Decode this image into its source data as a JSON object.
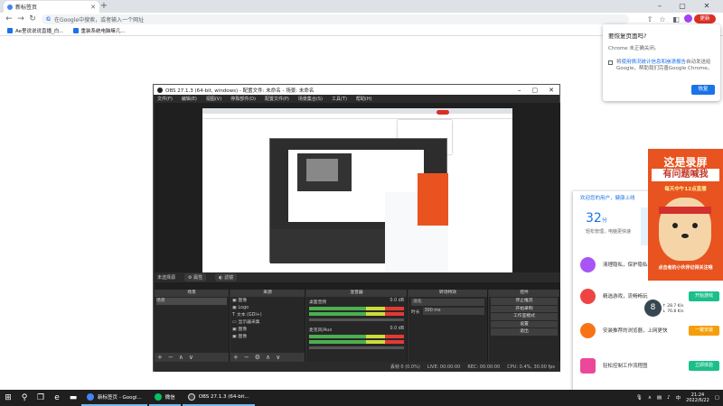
{
  "browser": {
    "tab_title": "新标签页",
    "omnibox_placeholder": "在Google中搜索，或者输入一个网址",
    "update_label": "更新",
    "bookmarks": [
      "Ae里说说说直播_白...",
      "重装系统电脑嘛几..."
    ]
  },
  "restore_popup": {
    "title": "要恢复页面吗?",
    "subtitle": "Chrome 未正确关闭。",
    "checkbox_text_a": "将",
    "checkbox_link": "使用情况统计信息和崩溃报告",
    "checkbox_text_b": "自动发送给Google，帮助我们完善Google Chrome。",
    "button": "恢复"
  },
  "obs": {
    "title": "OBS 27.1.3 (64-bit, windows) - 配置文件: 未命名 - 场景: 未命名",
    "menu": [
      "文件(F)",
      "编辑(E)",
      "视图(V)",
      "停靠部件(D)",
      "配置文件(P)",
      "场景集合(S)",
      "工具(T)",
      "帮助(H)"
    ],
    "source_bar": {
      "label": "未选择源",
      "props": "属性",
      "filters": "滤镜"
    },
    "panels": {
      "scenes": {
        "title": "场景",
        "items": [
          "场景"
        ]
      },
      "sources": {
        "title": "来源",
        "items": [
          "图像",
          "Logo",
          "文本 (GDI+)",
          "显示器采集",
          "图像",
          "图像"
        ]
      },
      "mixer": {
        "title": "混音器",
        "ch1": "桌面音频",
        "ch1_db": "0.0 dB",
        "ch2": "麦克风/Aux",
        "ch2_db": "0.0 dB"
      },
      "transitions": {
        "title": "转场特效",
        "type": "淡化",
        "duration_label": "时长",
        "duration_value": "300 ms"
      },
      "controls": {
        "title": "控件",
        "buttons": [
          "停止推流",
          "开始录制",
          "工作室模式",
          "设置",
          "退出"
        ]
      }
    },
    "status": {
      "dropped": "丢帧 0 (0.0%)",
      "live": "LIVE: 00:00:00",
      "rec": "REC: 00:00:00",
      "cpu": "CPU: 0.4%, 30.00 fps"
    }
  },
  "banner": {
    "line1": "这是录屏",
    "line2": "有问题喊我",
    "line3": "每天中午12点直播",
    "line4": "点击者的小伙伴记得关注哦"
  },
  "side_panel": {
    "header": "欢迎您的用户，健康上线",
    "score": "32",
    "score_unit": "分",
    "score_sub": "轻松管理，电脑更快速",
    "features": [
      {
        "text": "清理隐私，保护隐私安全",
        "button": "",
        "color": "#a855f7"
      },
      {
        "text": "精选游戏，流畅畅玩",
        "button": "开始游戏",
        "btn_color": "#1bbf8a",
        "color": "#ef4444"
      },
      {
        "text": "安装推荐的浏览器，上网更快",
        "button": "一键安装",
        "btn_color": "#f59e0b",
        "color": "#f97316"
      },
      {
        "text": "轻松控制工作流程图",
        "button": "立即体验",
        "btn_color": "#1bbf8a",
        "color": "#ec4899"
      }
    ]
  },
  "speed": {
    "ball": "8",
    "up": "↑ 28.7 K/s",
    "down": "↓ 76.8 K/s"
  },
  "taskbar": {
    "tasks": [
      "新标签页 - Googl...",
      "微信",
      "OBS 27.1.3 (64-bit..."
    ],
    "ime": "中",
    "time": "21:24",
    "date": "2022/6/22"
  }
}
